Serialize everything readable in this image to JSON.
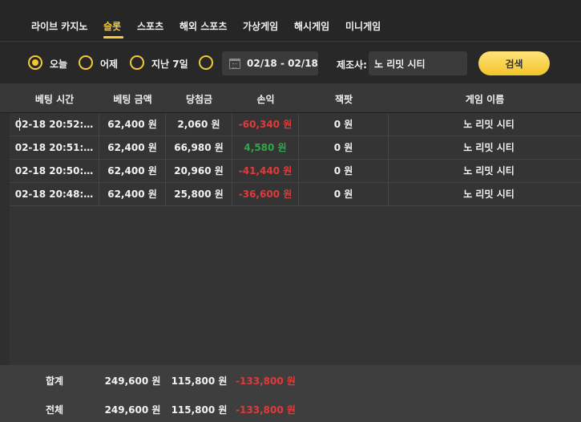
{
  "tabs": [
    {
      "label": "라이브 카지노"
    },
    {
      "label": "슬롯"
    },
    {
      "label": "스포츠"
    },
    {
      "label": "해외 스포츠"
    },
    {
      "label": "가상게임"
    },
    {
      "label": "해시게임"
    },
    {
      "label": "미니게임"
    }
  ],
  "active_tab": "슬롯",
  "filters": {
    "radios": [
      {
        "label": "오늘",
        "checked": true
      },
      {
        "label": "어제",
        "checked": false
      },
      {
        "label": "지난 7일",
        "checked": false
      },
      {
        "label": "",
        "checked": false
      }
    ],
    "date_range": "02/18 - 02/18",
    "provider_label": "제조사:",
    "provider_value": "노 리밋 시티",
    "search_label": "검색"
  },
  "table": {
    "headers": [
      "베팅 시간",
      "베팅 금액",
      "당첨금",
      "손익",
      "잭팟",
      "게임 이름"
    ],
    "rows": [
      {
        "time": "02-18 20:52:…",
        "bet": "62,400 원",
        "win": "2,060 원",
        "pnl": "-60,340 원",
        "pnl_sign": "neg",
        "jackpot": "0 원",
        "game": "노 리밋 시티"
      },
      {
        "time": "02-18 20:51:…",
        "bet": "62,400 원",
        "win": "66,980 원",
        "pnl": "4,580 원",
        "pnl_sign": "pos",
        "jackpot": "0 원",
        "game": "노 리밋 시티"
      },
      {
        "time": "02-18 20:50:…",
        "bet": "62,400 원",
        "win": "20,960 원",
        "pnl": "-41,440 원",
        "pnl_sign": "neg",
        "jackpot": "0 원",
        "game": "노 리밋 시티"
      },
      {
        "time": "02-18 20:48:…",
        "bet": "62,400 원",
        "win": "25,800 원",
        "pnl": "-36,600 원",
        "pnl_sign": "neg",
        "jackpot": "0 원",
        "game": "노 리밋 시티"
      }
    ]
  },
  "footer": {
    "subtotal": {
      "label": "합계",
      "bet": "249,600 원",
      "win": "115,800 원",
      "pnl": "-133,800 원"
    },
    "total": {
      "label": "전체",
      "bet": "249,600 원",
      "win": "115,800 원",
      "pnl": "-133,800 원"
    }
  },
  "colors": {
    "accent": "#f5c935",
    "negative": "#e03b3b",
    "positive": "#2ea84b"
  }
}
